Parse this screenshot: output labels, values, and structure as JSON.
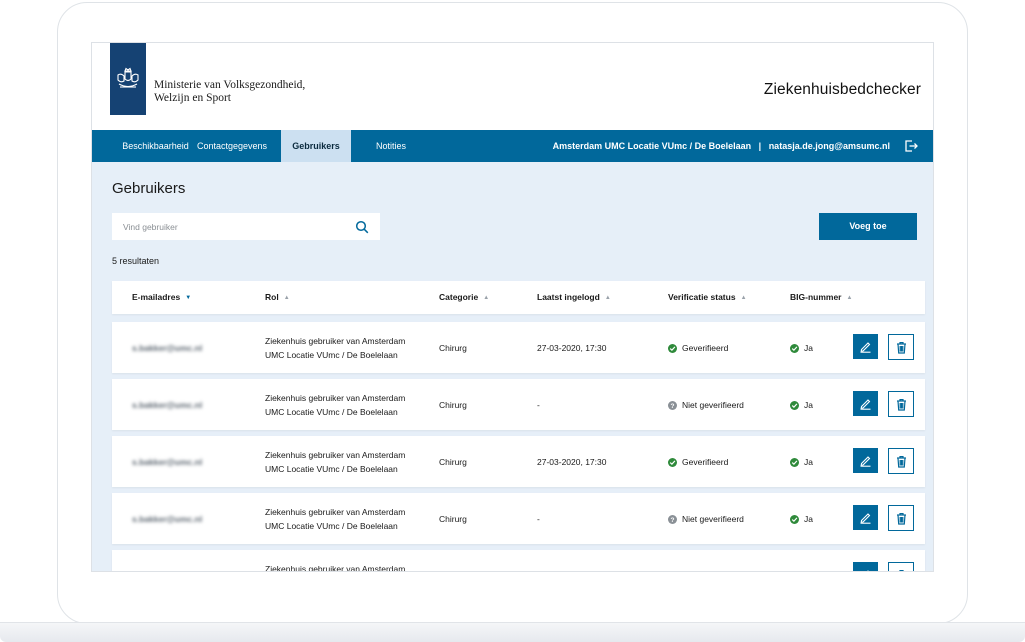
{
  "header": {
    "ministry_line1": "Ministerie van Volksgezondheid,",
    "ministry_line2": "Welzijn en Sport",
    "app_title": "Ziekenhuisbedchecker"
  },
  "nav": {
    "items": [
      {
        "label": "Beschikbaarheid",
        "active": false
      },
      {
        "label": "Contactgegevens",
        "active": false
      },
      {
        "label": "Gebruikers",
        "active": true
      },
      {
        "label": "Notities",
        "active": false
      }
    ],
    "location_user": "Amsterdam UMC Locatie VUmc / De Boelelaan   |   natasja.de.jong@amsumc.nl",
    "logout_icon": "logout-icon"
  },
  "page": {
    "title": "Gebruikers",
    "search_placeholder": "Vind gebruiker",
    "add_button": "Voeg toe",
    "results_count": "5 resultaten"
  },
  "table": {
    "columns": [
      "E-mailadres",
      "Rol",
      "Categorie",
      "Laatst ingelogd",
      "Verificatie status",
      "BIG-nummer"
    ],
    "sorted_column": "E-mailadres",
    "rows": [
      {
        "email": "s.bakker@umc.nl",
        "role_line1": "Ziekenhuis gebruiker van Amsterdam",
        "role_line2": "UMC Locatie VUmc / De Boelelaan",
        "category": "Chirurg",
        "last_login": "27-03-2020, 17:30",
        "verification": "Geverifieerd",
        "verified": true,
        "big": "Ja"
      },
      {
        "email": "s.bakker@umc.nl",
        "role_line1": "Ziekenhuis gebruiker van Amsterdam",
        "role_line2": "UMC Locatie VUmc / De Boelelaan",
        "category": "Chirurg",
        "last_login": "-",
        "verification": "Niet geverifieerd",
        "verified": false,
        "big": "Ja"
      },
      {
        "email": "s.bakker@umc.nl",
        "role_line1": "Ziekenhuis gebruiker van Amsterdam",
        "role_line2": "UMC Locatie VUmc / De Boelelaan",
        "category": "Chirurg",
        "last_login": "27-03-2020, 17:30",
        "verification": "Geverifieerd",
        "verified": true,
        "big": "Ja"
      },
      {
        "email": "s.bakker@umc.nl",
        "role_line1": "Ziekenhuis gebruiker van Amsterdam",
        "role_line2": "UMC Locatie VUmc / De Boelelaan",
        "category": "Chirurg",
        "last_login": "-",
        "verification": "Niet geverifieerd",
        "verified": false,
        "big": "Ja"
      },
      {
        "email": "",
        "role_line1": "Ziekenhuis gebruiker van Amsterdam",
        "role_line2": "",
        "category": "",
        "last_login": "",
        "verification": "",
        "verified": true,
        "big": ""
      }
    ]
  },
  "colors": {
    "primary": "#01689b",
    "logo": "#154273",
    "content_bg": "#e6eff8",
    "nav_active": "#cce0f1",
    "success": "#2f8a3b"
  }
}
